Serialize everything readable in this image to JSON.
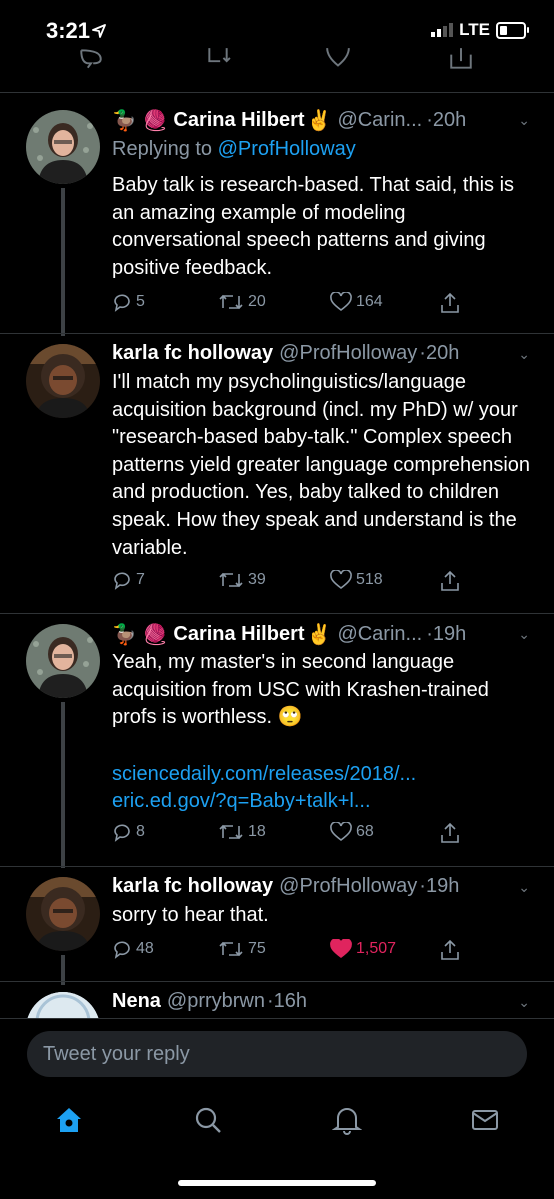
{
  "status": {
    "time": "3:21",
    "carrier": "LTE",
    "battery_level": 0.35
  },
  "tweets": [
    {
      "emoji_prefix": "🦆 🧶",
      "name": "Carina Hilbert",
      "name_emoji": "✌️",
      "handle": "@Carin...",
      "time": "·20h",
      "replying_label": "Replying to ",
      "replying_handle": "@ProfHolloway",
      "text": "Baby talk is research-based. That said, this is an amazing example of modeling conversational speech patterns and giving positive feedback.",
      "replies": "5",
      "retweets": "20",
      "likes": "164"
    },
    {
      "name": "karla fc holloway",
      "handle": "@ProfHolloway",
      "time": "·20h",
      "text": "I'll match my psycholinguistics/language acquisition background (incl. my PhD) w/ your \"research-based baby-talk.\" Complex speech patterns yield greater language comprehension and production. Yes, baby talked to children speak. How they speak and understand is the variable.",
      "replies": "7",
      "retweets": "39",
      "likes": "518"
    },
    {
      "emoji_prefix": "🦆 🧶",
      "name": "Carina Hilbert",
      "name_emoji": "✌️",
      "handle": "@Carin...",
      "time": "·19h",
      "text": "Yeah, my master's in second language acquisition from USC with Krashen-trained profs is worthless. 🙄",
      "link1": "sciencedaily.com/releases/2018/...",
      "link2": "eric.ed.gov/?q=Baby+talk+l...",
      "replies": "8",
      "retweets": "18",
      "likes": "68"
    },
    {
      "name": "karla fc holloway",
      "handle": "@ProfHolloway",
      "time": "·19h",
      "text": "sorry to hear that.",
      "replies": "48",
      "retweets": "75",
      "likes": "1,507"
    },
    {
      "name": "Nena",
      "handle": "@prrybrwn",
      "time": "·16h"
    }
  ],
  "reply_placeholder": "Tweet your reply",
  "colors": {
    "accent": "#1da1f2",
    "like": "#e0245e",
    "muted": "#8b98a5"
  },
  "tabs": [
    "home-icon",
    "search-icon",
    "notifications-icon",
    "messages-icon"
  ]
}
